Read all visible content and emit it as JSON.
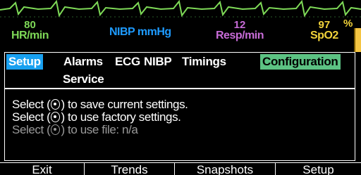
{
  "vitals": {
    "hr": {
      "value": "80",
      "unit": "HR/min"
    },
    "nibp": {
      "value": "",
      "unit": "NIBP mmHg"
    },
    "resp": {
      "value": "12",
      "unit": "Resp/min"
    },
    "spo2": {
      "value": "97",
      "unit": "SpO2",
      "percent": "%"
    }
  },
  "menu": {
    "tabs": [
      {
        "label": "Setup",
        "active": true
      },
      {
        "label": "Alarms"
      },
      {
        "label": "ECG"
      },
      {
        "label": "NIBP"
      },
      {
        "label": "Timings"
      },
      {
        "label": "Configuration",
        "highlighted": true
      },
      {
        "label": "Service"
      }
    ]
  },
  "settings": {
    "options": [
      {
        "prefix": "Select (",
        "suffix": ") to save current settings.",
        "enabled": true
      },
      {
        "prefix": "Select (",
        "suffix": ") to use factory settings.",
        "enabled": true
      },
      {
        "prefix": "Select (",
        "suffix": ") to use file: n/a",
        "enabled": false
      }
    ]
  },
  "softkeys": [
    {
      "label": "Exit"
    },
    {
      "label": "Trends"
    },
    {
      "label": "Snapshots"
    },
    {
      "label": "Setup"
    }
  ],
  "colors": {
    "hr": "#7ed957",
    "nibp": "#1e9bff",
    "resp": "#c86cd8",
    "spo2": "#f2d33a",
    "active_tab": "#18a0f0",
    "highlight_tab": "#5cc283"
  }
}
